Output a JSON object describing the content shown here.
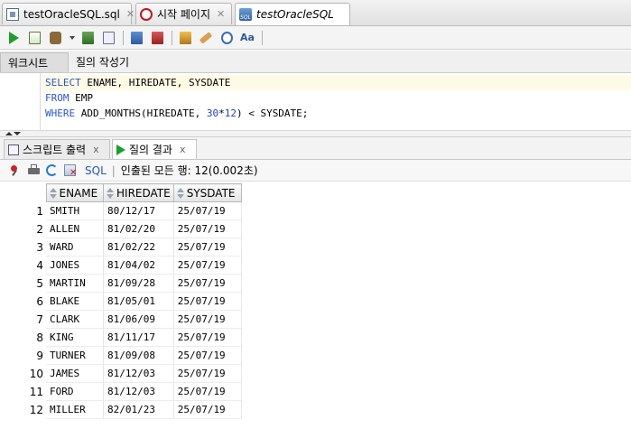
{
  "doc_tabs": [
    {
      "label": "testOracleSQL.sql",
      "icon": "sql-file-icon",
      "close": "✕"
    },
    {
      "label": "시작 페이지",
      "icon": "oracle-icon",
      "close": "✕"
    },
    {
      "label": "testOracleSQL",
      "icon": "sql-worksheet-icon",
      "close": ""
    }
  ],
  "worksheet_tabs": [
    "워크시트",
    "질의 작성기"
  ],
  "editor": {
    "lines": [
      {
        "kw": "SELECT",
        "rest": " ENAME, HIREDATE, SYSDATE"
      },
      {
        "kw": "FROM",
        "rest": " EMP"
      },
      {
        "kw": "WHERE",
        "rest": " ADD_MONTHS(HIREDATE, ",
        "num": "30",
        "op": "*",
        "num2": "12",
        "rest2": ") < SYSDATE;"
      }
    ]
  },
  "output_tabs": [
    {
      "label": "스크립트 출력",
      "icon": "script-output-icon",
      "close": "x"
    },
    {
      "label": "질의 결과",
      "icon": "run-icon",
      "close": "x"
    }
  ],
  "results_toolbar": {
    "sql_label": "SQL",
    "divider": "|",
    "status": "인출된 모든 행: 12(0.002초)"
  },
  "grid": {
    "columns": [
      "ENAME",
      "HIREDATE",
      "SYSDATE"
    ],
    "rows": [
      [
        "1",
        "SMITH",
        "80/12/17",
        "25/07/19"
      ],
      [
        "2",
        "ALLEN",
        "81/02/20",
        "25/07/19"
      ],
      [
        "3",
        "WARD",
        "81/02/22",
        "25/07/19"
      ],
      [
        "4",
        "JONES",
        "81/04/02",
        "25/07/19"
      ],
      [
        "5",
        "MARTIN",
        "81/09/28",
        "25/07/19"
      ],
      [
        "6",
        "BLAKE",
        "81/05/01",
        "25/07/19"
      ],
      [
        "7",
        "CLARK",
        "81/06/09",
        "25/07/19"
      ],
      [
        "8",
        "KING",
        "81/11/17",
        "25/07/19"
      ],
      [
        "9",
        "TURNER",
        "81/09/08",
        "25/07/19"
      ],
      [
        "10",
        "JAMES",
        "81/12/03",
        "25/07/19"
      ],
      [
        "11",
        "FORD",
        "81/12/03",
        "25/07/19"
      ],
      [
        "12",
        "MILLER",
        "82/01/23",
        "25/07/19"
      ]
    ]
  },
  "colors": {
    "keyword": "#2b55c5",
    "run_green": "#1f9d2b",
    "oracle_red": "#c4151c"
  }
}
